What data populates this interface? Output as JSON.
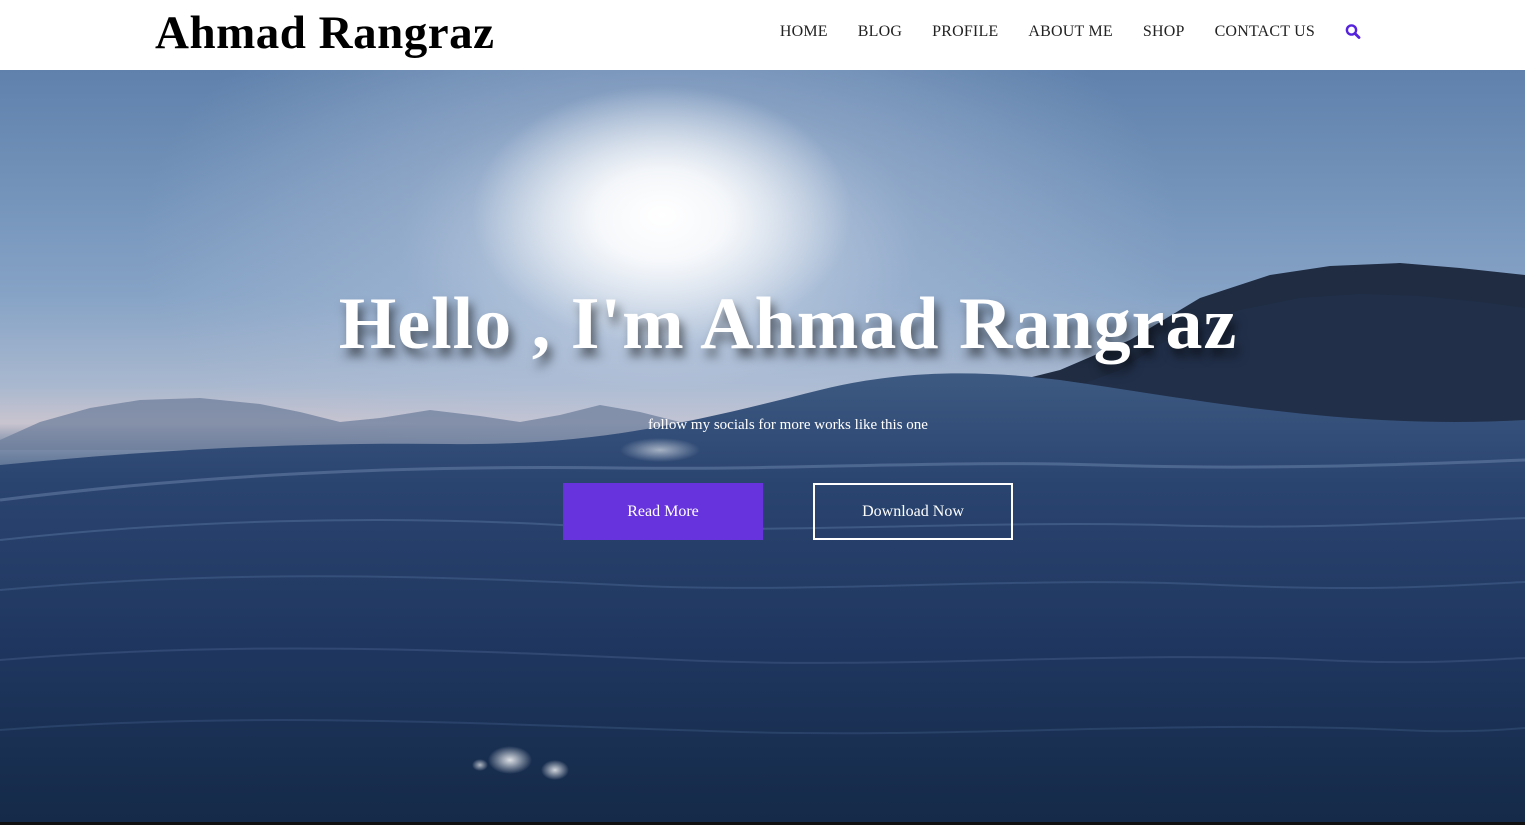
{
  "site": {
    "logo": "Ahmad Rangraz"
  },
  "nav": {
    "items": [
      "HOME",
      "BLOG",
      "PROFILE",
      "ABOUT ME",
      "SHOP",
      "CONTACT US"
    ],
    "search_icon": "search-icon",
    "accent_color": "#5522dd"
  },
  "hero": {
    "title": "Hello , I'm Ahmad Rangraz",
    "subtitle": "follow my socials for more works like this one",
    "primary_button": "Read More",
    "secondary_button": "Download Now",
    "primary_color": "#6633dd"
  }
}
